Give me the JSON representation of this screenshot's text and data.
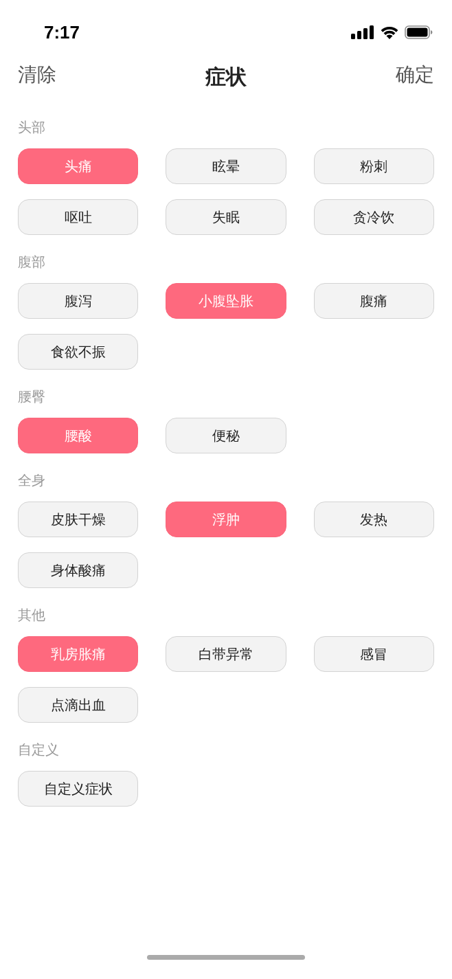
{
  "status_bar": {
    "time": "7:17"
  },
  "header": {
    "left_action": "清除",
    "title": "症状",
    "right_action": "确定"
  },
  "sections": [
    {
      "title": "头部",
      "items": [
        {
          "label": "头痛",
          "selected": true
        },
        {
          "label": "眩晕",
          "selected": false
        },
        {
          "label": "粉刺",
          "selected": false
        },
        {
          "label": "呕吐",
          "selected": false
        },
        {
          "label": "失眠",
          "selected": false
        },
        {
          "label": "贪冷饮",
          "selected": false
        }
      ]
    },
    {
      "title": "腹部",
      "items": [
        {
          "label": "腹泻",
          "selected": false
        },
        {
          "label": "小腹坠胀",
          "selected": true
        },
        {
          "label": "腹痛",
          "selected": false
        },
        {
          "label": "食欲不振",
          "selected": false
        }
      ]
    },
    {
      "title": "腰臀",
      "items": [
        {
          "label": "腰酸",
          "selected": true
        },
        {
          "label": "便秘",
          "selected": false
        }
      ]
    },
    {
      "title": "全身",
      "items": [
        {
          "label": "皮肤干燥",
          "selected": false
        },
        {
          "label": "浮肿",
          "selected": true
        },
        {
          "label": "发热",
          "selected": false
        },
        {
          "label": "身体酸痛",
          "selected": false
        }
      ]
    },
    {
      "title": "其他",
      "items": [
        {
          "label": "乳房胀痛",
          "selected": true
        },
        {
          "label": "白带异常",
          "selected": false
        },
        {
          "label": "感冒",
          "selected": false
        },
        {
          "label": "点滴出血",
          "selected": false
        }
      ]
    },
    {
      "title": "自定义",
      "items": [
        {
          "label": "自定义症状",
          "selected": false
        }
      ]
    }
  ]
}
